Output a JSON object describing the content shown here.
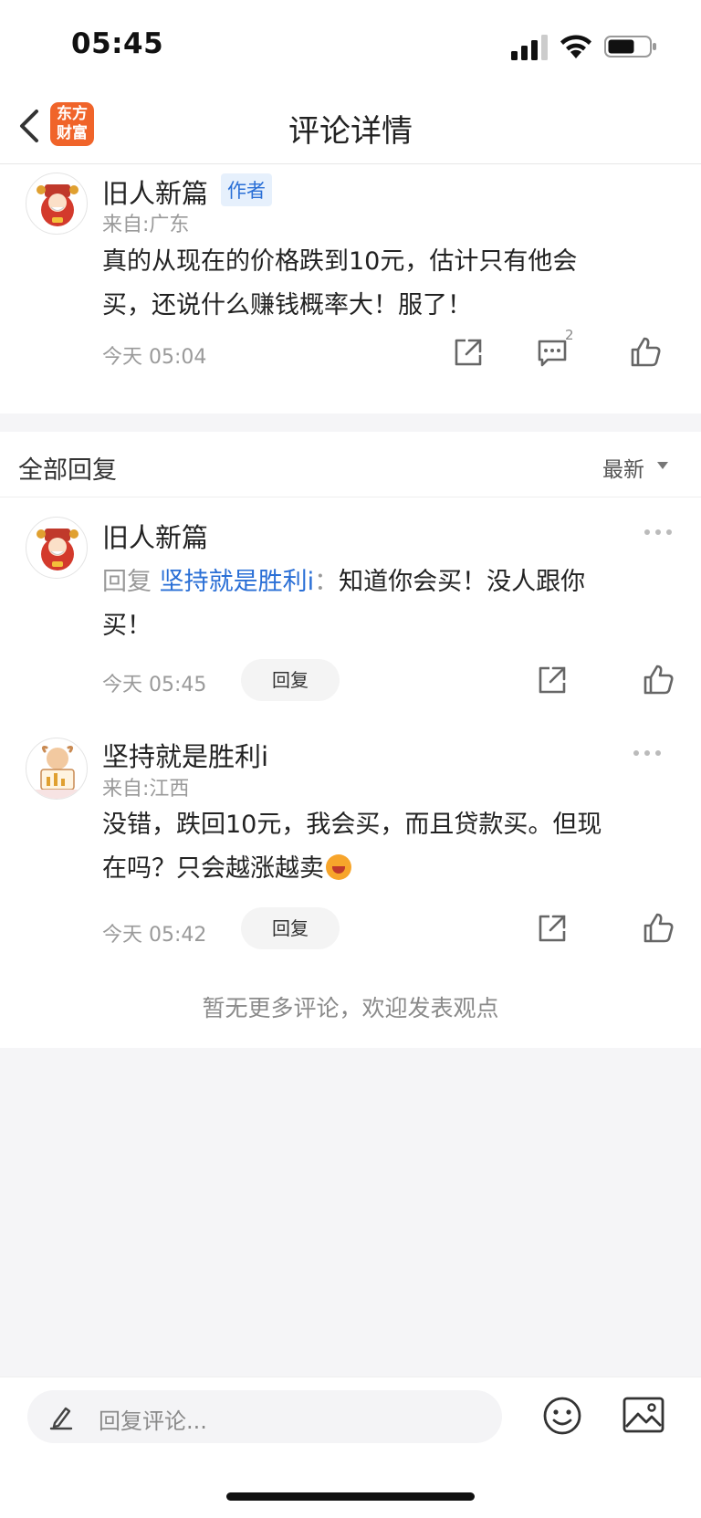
{
  "status": {
    "time": "05:45"
  },
  "nav": {
    "title": "评论详情",
    "logo_text_line1": "东方",
    "logo_text_line2": "财富"
  },
  "post": {
    "username": "旧人新篇",
    "author_tag": "作者",
    "location": "来自:广东",
    "content_line1": "真的从现在的价格跌到10元，估计只有他会",
    "content_line2": "买，还说什么赚钱概率大！服了！",
    "time": "今天 05:04",
    "comment_count": "2"
  },
  "replies_header": {
    "title": "全部回复",
    "sort": "最新"
  },
  "replies": [
    {
      "username": "旧人新篇",
      "reply_prefix": "回复",
      "reply_target": "坚持就是胜利i",
      "reply_colon": "：",
      "content_rest": "知道你会买！没人跟你",
      "content_line2": "买！",
      "time": "今天 05:45",
      "reply_button": "回复"
    },
    {
      "username": "坚持就是胜利i",
      "location": "来自:江西",
      "content_line1": "没错，跌回10元，我会买，而且贷款买。但现",
      "content_line2": "在吗？只会越涨越卖",
      "emoji": "laughing-emoji",
      "time": "今天 05:42",
      "reply_button": "回复"
    }
  ],
  "footer_note": "暂无更多评论，欢迎发表观点",
  "bottom": {
    "input_placeholder": "回复评论..."
  },
  "colors": {
    "accent_blue": "#2a6fd6",
    "logo_orange": "#f0642a",
    "gray_bg": "#f5f5f7"
  }
}
